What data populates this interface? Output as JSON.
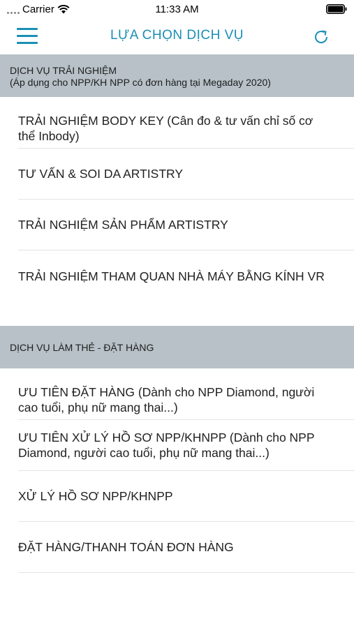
{
  "status_bar": {
    "carrier": "Carrier",
    "time": "11:33 AM"
  },
  "nav": {
    "title": "LỰA CHỌN DỊCH VỤ"
  },
  "sections": [
    {
      "title": "DỊCH VỤ TRẢI NGHIỆM",
      "subtitle": "(Áp dụng cho NPP/KH NPP có đơn hàng tại Megaday 2020)",
      "items": [
        {
          "label": "TRẢI NGHIỆM BODY KEY (Cân đo & tư vấn chỉ số cơ thể Inbody)"
        },
        {
          "label": "TƯ VẤN & SOI DA ARTISTRY"
        },
        {
          "label": "TRẢI NGHIỆM SẢN PHẨM ARTISTRY"
        },
        {
          "label": "TRẢI NGHIỆM THAM QUAN NHÀ MÁY BẰNG KÍNH VR"
        }
      ]
    },
    {
      "title": "DỊCH VỤ LÀM THẺ - ĐẶT HÀNG",
      "items": [
        {
          "label": "ƯU TIÊN ĐẶT HÀNG (Dành cho NPP Diamond, người cao tuổi, phụ nữ mang thai...)"
        },
        {
          "label": "ƯU TIÊN XỬ LÝ HỒ SƠ NPP/KHNPP (Dành cho NPP Diamond, người cao tuổi, phụ nữ mang thai...)"
        },
        {
          "label": "XỬ LÝ HỒ SƠ NPP/KHNPP"
        },
        {
          "label": "ĐẶT HÀNG/THANH TOÁN ĐƠN HÀNG"
        }
      ]
    }
  ],
  "colors": {
    "accent": "#1a8fb5",
    "section_bg": "#b7c1c7"
  }
}
